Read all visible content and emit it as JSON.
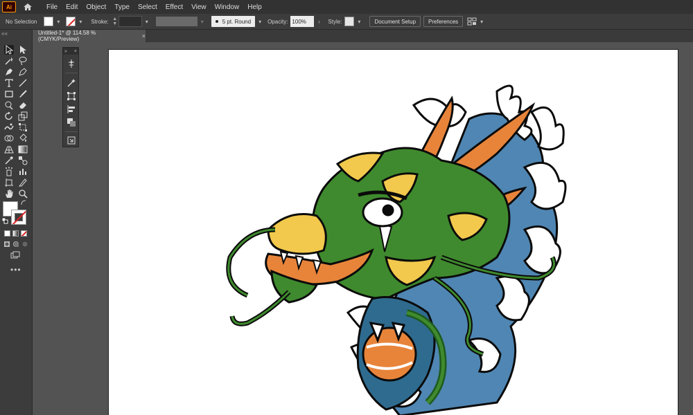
{
  "app": {
    "logo_text": "Ai"
  },
  "menu": [
    "File",
    "Edit",
    "Object",
    "Type",
    "Select",
    "Effect",
    "View",
    "Window",
    "Help"
  ],
  "control_bar": {
    "selection_label": "No Selection",
    "stroke_label": "Stroke:",
    "brush_label": "5 pt. Round",
    "opacity_label": "Opacity:",
    "opacity_value": "100%",
    "style_label": "Style:",
    "document_setup_label": "Document Setup",
    "preferences_label": "Preferences"
  },
  "document_tab": {
    "title": "Untitled-1* @ 114.58 % (CMYK/Preview)",
    "close": "×"
  },
  "tool_panel": {
    "grip": "««",
    "more": "•••"
  },
  "float_panel": {
    "grip": "»",
    "close": "×"
  },
  "colors": {
    "accent": "#ff9a00",
    "dragon_green": "#3f8a2e",
    "dragon_yellow": "#f2c94c",
    "dragon_orange": "#e8843a",
    "wave_blue": "#4f86b3"
  }
}
